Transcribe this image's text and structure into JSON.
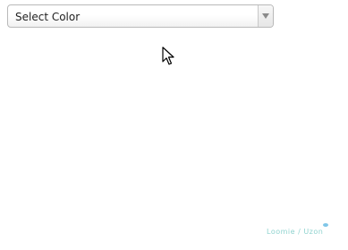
{
  "color_select": {
    "value": "Select Color"
  },
  "watermark": {
    "text": "Loomie / Uzon"
  },
  "colors": {
    "border": "#b9b9b9",
    "text": "#222222",
    "arrow": "#8a8a8a",
    "watermark": "#8fd3cf"
  },
  "icons": {
    "dropdown": "triangle-down-icon",
    "pointer": "mouse-cursor-icon"
  }
}
